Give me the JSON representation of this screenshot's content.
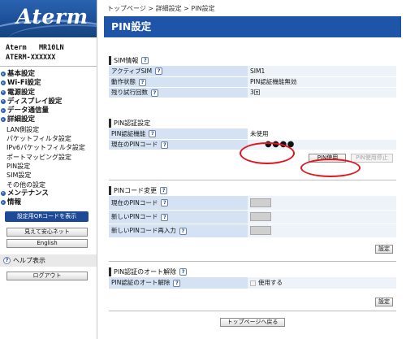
{
  "sidebar": {
    "logo": "Aterm",
    "model_line1": "Aterm   MR10LN",
    "model_line2": "ATERM-XXXXXX",
    "nav": [
      {
        "label": "基本設定",
        "level": "top"
      },
      {
        "label": "Wi-Fi設定",
        "level": "top"
      },
      {
        "label": "電源設定",
        "level": "top"
      },
      {
        "label": "ディスプレイ設定",
        "level": "top"
      },
      {
        "label": "データ通信量",
        "level": "top"
      },
      {
        "label": "詳細設定",
        "level": "top"
      },
      {
        "label": "LAN側設定",
        "level": "sub"
      },
      {
        "label": "パケットフィルタ設定",
        "level": "sub"
      },
      {
        "label": "IPv6パケットフィルタ設定",
        "level": "sub"
      },
      {
        "label": "ポートマッピング設定",
        "level": "sub"
      },
      {
        "label": "PIN設定",
        "level": "sub"
      },
      {
        "label": "SIM設定",
        "level": "sub"
      },
      {
        "label": "その他の設定",
        "level": "sub"
      },
      {
        "label": "メンテナンス",
        "level": "top"
      },
      {
        "label": "情報",
        "level": "top"
      }
    ],
    "qr_button": "設定用QRコードを表示",
    "mieteanshin_button": "見えて安心ネット",
    "english_button": "English",
    "help_label": "ヘルプ表示",
    "logout_button": "ログアウト"
  },
  "main": {
    "breadcrumb": "トップページ > 詳細設定 > PIN設定",
    "title": "PIN設定",
    "help_icon": "?",
    "sim_info": {
      "heading": "SIM情報",
      "rows": [
        {
          "label": "アクティブSIM",
          "value": "SIM1"
        },
        {
          "label": "動作状態",
          "value": "PIN認証機能無効"
        },
        {
          "label": "残り試行回数",
          "value": "3回"
        }
      ]
    },
    "pin_auth": {
      "heading": "PIN認証設定",
      "function_label": "PIN認証機能",
      "function_value": "未使用",
      "current_pin_label": "現在のPINコード",
      "current_pin_value": "●●●●",
      "use_button": "PIN使用",
      "stop_button": "PIN使用停止"
    },
    "pin_change": {
      "heading": "PINコード変更",
      "rows": [
        {
          "label": "現在のPINコード"
        },
        {
          "label": "新しいPINコード"
        },
        {
          "label": "新しいPINコード再入力"
        }
      ],
      "set_button": "設定"
    },
    "auto_release": {
      "heading": "PIN認証のオート解除",
      "row_label": "PIN認証のオート解除",
      "checkbox_label": "使用する",
      "set_button": "設定"
    },
    "back_button": "トップページへ戻る"
  },
  "colors": {
    "accent": "#1f55a8",
    "label_cell": "#d4e2f4",
    "value_cell": "#eef3fa",
    "highlight": "#e2141e"
  }
}
